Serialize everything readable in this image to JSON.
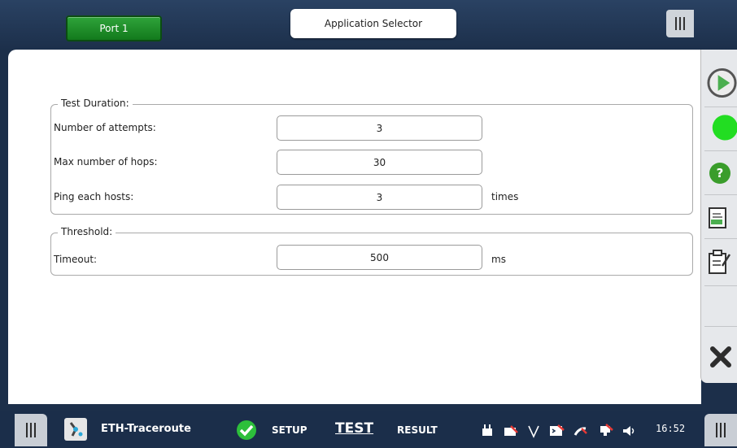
{
  "header": {
    "port_label": "Port 1",
    "app_selector_label": "Application Selector"
  },
  "test_duration": {
    "legend": "Test Duration:",
    "rows": [
      {
        "label": "Number of attempts:",
        "value": "3",
        "unit": ""
      },
      {
        "label": "Max number of hops:",
        "value": "30",
        "unit": ""
      },
      {
        "label": "Ping each hosts:",
        "value": "3",
        "unit": "times"
      }
    ]
  },
  "threshold": {
    "legend": "Threshold:",
    "rows": [
      {
        "label": "Timeout:",
        "value": "500",
        "unit": "ms"
      }
    ]
  },
  "sidebar": {
    "icons": [
      "play-icon",
      "status-indicator-icon",
      "help-icon",
      "report-icon",
      "edit-report-icon",
      "close-icon"
    ],
    "status_color": "#22dd22",
    "help_color": "#3a9d2b"
  },
  "bottombar": {
    "app_name": "ETH-Traceroute",
    "tabs": {
      "setup": "SETUP",
      "test": "TEST",
      "result": "RESULT"
    },
    "active_tab": "TEST",
    "status_icons": [
      "power-plug-icon",
      "camera-off-icon",
      "v-icon",
      "terminal-off-icon",
      "satellite-off-icon",
      "network-off-icon",
      "speaker-icon"
    ],
    "time": "16:52"
  },
  "colors": {
    "frame": "#1c2f4a",
    "port_button": "#1f8c2a",
    "panel": "#ffffff"
  }
}
